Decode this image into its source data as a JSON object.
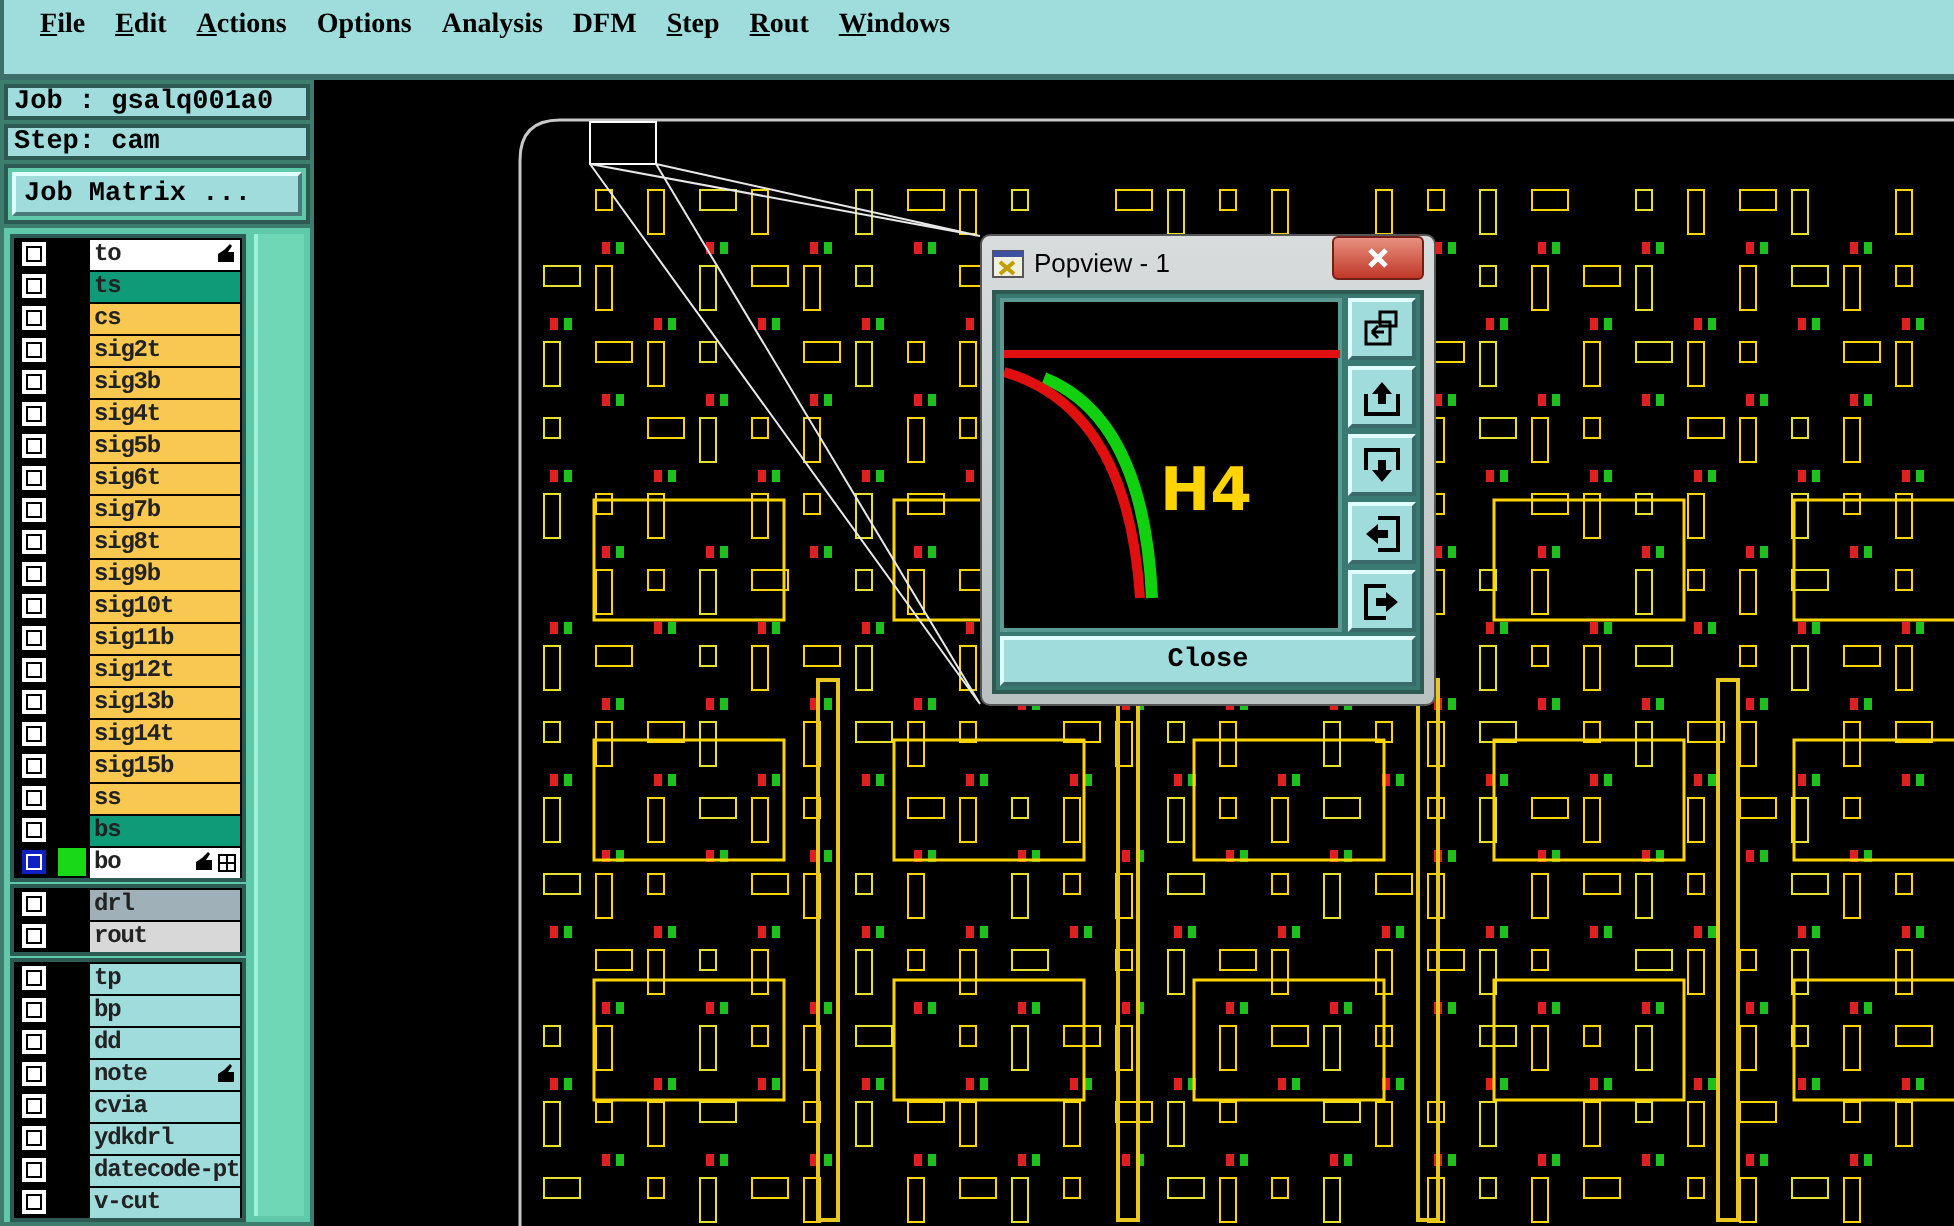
{
  "menu": [
    {
      "label": "File",
      "mnemonic": true
    },
    {
      "label": "Edit",
      "mnemonic": true
    },
    {
      "label": "Actions",
      "mnemonic": true
    },
    {
      "label": "Options",
      "mnemonic": false
    },
    {
      "label": "Analysis",
      "mnemonic": false
    },
    {
      "label": "DFM",
      "mnemonic": false
    },
    {
      "label": "Step",
      "mnemonic": true
    },
    {
      "label": "Rout",
      "mnemonic": true
    },
    {
      "label": "Windows",
      "mnemonic": true
    }
  ],
  "job": {
    "label": "Job : gsalq001a0"
  },
  "step": {
    "label": "Step: cam"
  },
  "job_matrix_button": "Job Matrix ...",
  "layer_groups": [
    {
      "layers": [
        {
          "name": "to",
          "color": "#ffffff",
          "selected": false,
          "displayed": false,
          "hand": true,
          "grid": false
        },
        {
          "name": "ts",
          "color": "#0f9a78",
          "selected": false,
          "displayed": false,
          "hand": false,
          "grid": false
        },
        {
          "name": "cs",
          "color": "#f8c850",
          "selected": false,
          "displayed": false,
          "hand": false,
          "grid": false
        },
        {
          "name": "sig2t",
          "color": "#f8c850",
          "selected": false,
          "displayed": false,
          "hand": false,
          "grid": false
        },
        {
          "name": "sig3b",
          "color": "#f8c850",
          "selected": false,
          "displayed": false,
          "hand": false,
          "grid": false
        },
        {
          "name": "sig4t",
          "color": "#f8c850",
          "selected": false,
          "displayed": false,
          "hand": false,
          "grid": false
        },
        {
          "name": "sig5b",
          "color": "#f8c850",
          "selected": false,
          "displayed": false,
          "hand": false,
          "grid": false
        },
        {
          "name": "sig6t",
          "color": "#f8c850",
          "selected": false,
          "displayed": false,
          "hand": false,
          "grid": false
        },
        {
          "name": "sig7b",
          "color": "#f8c850",
          "selected": false,
          "displayed": false,
          "hand": false,
          "grid": false
        },
        {
          "name": "sig8t",
          "color": "#f8c850",
          "selected": false,
          "displayed": false,
          "hand": false,
          "grid": false
        },
        {
          "name": "sig9b",
          "color": "#f8c850",
          "selected": false,
          "displayed": false,
          "hand": false,
          "grid": false
        },
        {
          "name": "sig10t",
          "color": "#f8c850",
          "selected": false,
          "displayed": false,
          "hand": false,
          "grid": false
        },
        {
          "name": "sig11b",
          "color": "#f8c850",
          "selected": false,
          "displayed": false,
          "hand": false,
          "grid": false
        },
        {
          "name": "sig12t",
          "color": "#f8c850",
          "selected": false,
          "displayed": false,
          "hand": false,
          "grid": false
        },
        {
          "name": "sig13b",
          "color": "#f8c850",
          "selected": false,
          "displayed": false,
          "hand": false,
          "grid": false
        },
        {
          "name": "sig14t",
          "color": "#f8c850",
          "selected": false,
          "displayed": false,
          "hand": false,
          "grid": false
        },
        {
          "name": "sig15b",
          "color": "#f8c850",
          "selected": false,
          "displayed": false,
          "hand": false,
          "grid": false
        },
        {
          "name": "ss",
          "color": "#f8c850",
          "selected": false,
          "displayed": false,
          "hand": false,
          "grid": false
        },
        {
          "name": "bs",
          "color": "#0f9a78",
          "selected": false,
          "displayed": false,
          "hand": false,
          "grid": false
        },
        {
          "name": "bo",
          "color": "#ffffff",
          "selected": true,
          "displayed": true,
          "hand": true,
          "grid": true
        }
      ]
    },
    {
      "layers": [
        {
          "name": "drl",
          "color": "#9fb0b8",
          "selected": false,
          "displayed": false,
          "hand": false,
          "grid": false
        },
        {
          "name": "rout",
          "color": "#d8d8d8",
          "selected": false,
          "displayed": false,
          "hand": false,
          "grid": false
        }
      ]
    },
    {
      "layers": [
        {
          "name": "tp",
          "color": "#a0dcdc",
          "selected": false,
          "displayed": false,
          "hand": false,
          "grid": false
        },
        {
          "name": "bp",
          "color": "#a0dcdc",
          "selected": false,
          "displayed": false,
          "hand": false,
          "grid": false
        },
        {
          "name": "dd",
          "color": "#a0dcdc",
          "selected": false,
          "displayed": false,
          "hand": false,
          "grid": false
        },
        {
          "name": "note",
          "color": "#a0dcdc",
          "selected": false,
          "displayed": false,
          "hand": true,
          "grid": false
        },
        {
          "name": "cvia",
          "color": "#a0dcdc",
          "selected": false,
          "displayed": false,
          "hand": false,
          "grid": false
        },
        {
          "name": "ydkdrl",
          "color": "#a0dcdc",
          "selected": false,
          "displayed": false,
          "hand": false,
          "grid": false
        },
        {
          "name": "datecode-pt",
          "color": "#a0dcdc",
          "selected": false,
          "displayed": false,
          "hand": false,
          "grid": false
        },
        {
          "name": "v-cut",
          "color": "#a0dcdc",
          "selected": false,
          "displayed": false,
          "hand": false,
          "grid": false
        }
      ]
    }
  ],
  "popview": {
    "title": "Popview - 1",
    "zoom_label": "H4",
    "close_button": "Close"
  }
}
